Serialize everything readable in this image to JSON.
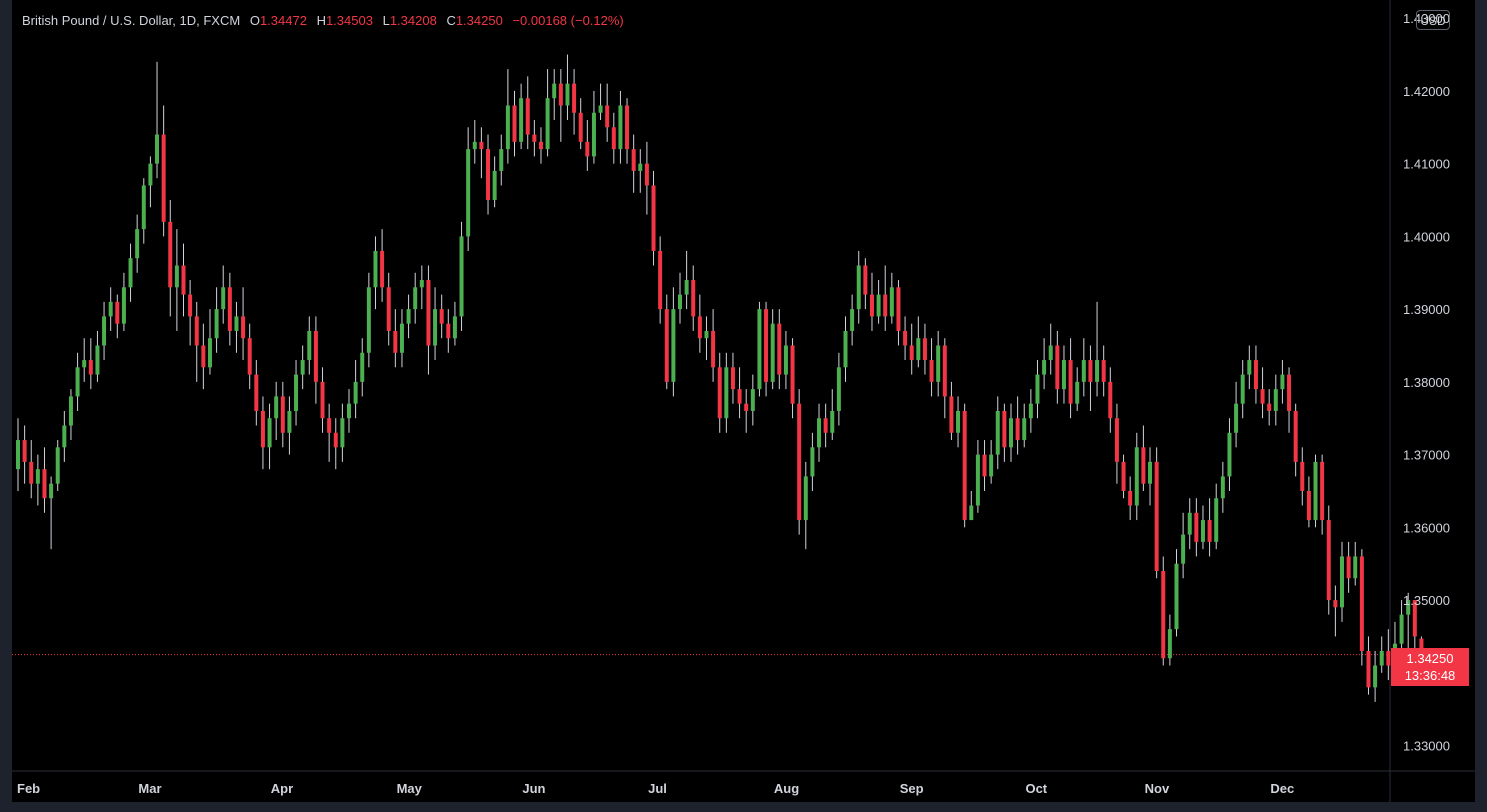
{
  "header": {
    "symbol": "British Pound / U.S. Dollar, 1D, FXCM",
    "open_label": "O",
    "open": "1.34472",
    "high_label": "H",
    "high": "1.34503",
    "low_label": "L",
    "low": "1.34208",
    "close_label": "C",
    "close": "1.34250",
    "change": "−0.00168 (−0.12%)"
  },
  "currency": "USD",
  "last_price": {
    "price": "1.34250",
    "countdown": "13:36:48",
    "value": 1.3425
  },
  "colors": {
    "up": "#4caf50",
    "down": "#f23645",
    "background": "#000000",
    "text": "#d1d4dc"
  },
  "chart_data": {
    "type": "candlestick",
    "y_ticks": [
      "1.43000",
      "1.42000",
      "1.41000",
      "1.40000",
      "1.39000",
      "1.38000",
      "1.37000",
      "1.36000",
      "1.35000",
      "1.34000",
      "1.33000"
    ],
    "ylim": [
      1.3265,
      1.4325
    ],
    "x_ticks": [
      {
        "label": "Feb",
        "index": 0
      },
      {
        "label": "Mar",
        "index": 20
      },
      {
        "label": "Apr",
        "index": 40
      },
      {
        "label": "May",
        "index": 59
      },
      {
        "label": "Jun",
        "index": 78
      },
      {
        "label": "Jul",
        "index": 97
      },
      {
        "label": "Aug",
        "index": 116
      },
      {
        "label": "Sep",
        "index": 135
      },
      {
        "label": "Oct",
        "index": 154
      },
      {
        "label": "Nov",
        "index": 172
      },
      {
        "label": "Dec",
        "index": 191
      }
    ],
    "candles": [
      [
        1.368,
        1.372,
        1.375,
        1.365
      ],
      [
        1.372,
        1.369,
        1.374,
        1.366
      ],
      [
        1.369,
        1.366,
        1.372,
        1.364
      ],
      [
        1.366,
        1.368,
        1.37,
        1.363
      ],
      [
        1.368,
        1.364,
        1.371,
        1.362
      ],
      [
        1.364,
        1.366,
        1.367,
        1.357
      ],
      [
        1.366,
        1.371,
        1.372,
        1.365
      ],
      [
        1.371,
        1.374,
        1.376,
        1.369
      ],
      [
        1.374,
        1.378,
        1.379,
        1.372
      ],
      [
        1.378,
        1.382,
        1.384,
        1.376
      ],
      [
        1.382,
        1.383,
        1.386,
        1.38
      ],
      [
        1.383,
        1.381,
        1.386,
        1.379
      ],
      [
        1.381,
        1.385,
        1.387,
        1.38
      ],
      [
        1.385,
        1.389,
        1.391,
        1.383
      ],
      [
        1.389,
        1.391,
        1.393,
        1.387
      ],
      [
        1.391,
        1.388,
        1.392,
        1.386
      ],
      [
        1.388,
        1.393,
        1.395,
        1.387
      ],
      [
        1.393,
        1.397,
        1.399,
        1.391
      ],
      [
        1.397,
        1.401,
        1.403,
        1.395
      ],
      [
        1.401,
        1.407,
        1.408,
        1.399
      ],
      [
        1.407,
        1.41,
        1.411,
        1.404
      ],
      [
        1.41,
        1.414,
        1.424,
        1.408
      ],
      [
        1.414,
        1.402,
        1.418,
        1.4
      ],
      [
        1.402,
        1.393,
        1.405,
        1.389
      ],
      [
        1.393,
        1.396,
        1.401,
        1.387
      ],
      [
        1.396,
        1.392,
        1.399,
        1.389
      ],
      [
        1.392,
        1.389,
        1.394,
        1.385
      ],
      [
        1.389,
        1.385,
        1.391,
        1.38
      ],
      [
        1.385,
        1.382,
        1.388,
        1.379
      ],
      [
        1.382,
        1.386,
        1.39,
        1.381
      ],
      [
        1.386,
        1.39,
        1.393,
        1.384
      ],
      [
        1.39,
        1.393,
        1.396,
        1.388
      ],
      [
        1.393,
        1.387,
        1.395,
        1.385
      ],
      [
        1.387,
        1.389,
        1.391,
        1.384
      ],
      [
        1.389,
        1.386,
        1.393,
        1.383
      ],
      [
        1.386,
        1.381,
        1.388,
        1.379
      ],
      [
        1.381,
        1.376,
        1.383,
        1.374
      ],
      [
        1.376,
        1.371,
        1.378,
        1.368
      ],
      [
        1.371,
        1.375,
        1.377,
        1.368
      ],
      [
        1.375,
        1.378,
        1.38,
        1.372
      ],
      [
        1.378,
        1.373,
        1.38,
        1.371
      ],
      [
        1.373,
        1.376,
        1.378,
        1.37
      ],
      [
        1.376,
        1.381,
        1.383,
        1.374
      ],
      [
        1.381,
        1.383,
        1.385,
        1.379
      ],
      [
        1.383,
        1.387,
        1.389,
        1.381
      ],
      [
        1.387,
        1.38,
        1.389,
        1.377
      ],
      [
        1.38,
        1.375,
        1.382,
        1.373
      ],
      [
        1.375,
        1.373,
        1.377,
        1.369
      ],
      [
        1.373,
        1.371,
        1.375,
        1.368
      ],
      [
        1.371,
        1.375,
        1.377,
        1.369
      ],
      [
        1.375,
        1.377,
        1.379,
        1.373
      ],
      [
        1.377,
        1.38,
        1.383,
        1.375
      ],
      [
        1.38,
        1.384,
        1.386,
        1.378
      ],
      [
        1.384,
        1.393,
        1.395,
        1.382
      ],
      [
        1.393,
        1.398,
        1.4,
        1.39
      ],
      [
        1.398,
        1.393,
        1.401,
        1.391
      ],
      [
        1.393,
        1.387,
        1.395,
        1.385
      ],
      [
        1.387,
        1.384,
        1.39,
        1.382
      ],
      [
        1.384,
        1.388,
        1.39,
        1.382
      ],
      [
        1.388,
        1.39,
        1.392,
        1.386
      ],
      [
        1.39,
        1.393,
        1.395,
        1.388
      ],
      [
        1.393,
        1.394,
        1.396,
        1.39
      ],
      [
        1.394,
        1.385,
        1.396,
        1.381
      ],
      [
        1.385,
        1.39,
        1.393,
        1.383
      ],
      [
        1.39,
        1.388,
        1.392,
        1.386
      ],
      [
        1.388,
        1.386,
        1.39,
        1.384
      ],
      [
        1.386,
        1.389,
        1.391,
        1.385
      ],
      [
        1.389,
        1.4,
        1.402,
        1.387
      ],
      [
        1.4,
        1.412,
        1.415,
        1.398
      ],
      [
        1.412,
        1.413,
        1.416,
        1.41
      ],
      [
        1.413,
        1.412,
        1.415,
        1.408
      ],
      [
        1.412,
        1.405,
        1.414,
        1.403
      ],
      [
        1.405,
        1.409,
        1.411,
        1.404
      ],
      [
        1.409,
        1.412,
        1.414,
        1.407
      ],
      [
        1.412,
        1.418,
        1.423,
        1.41
      ],
      [
        1.418,
        1.413,
        1.42,
        1.411
      ],
      [
        1.413,
        1.419,
        1.421,
        1.412
      ],
      [
        1.419,
        1.414,
        1.422,
        1.412
      ],
      [
        1.414,
        1.413,
        1.416,
        1.411
      ],
      [
        1.413,
        1.412,
        1.415,
        1.41
      ],
      [
        1.412,
        1.419,
        1.423,
        1.411
      ],
      [
        1.419,
        1.421,
        1.423,
        1.416
      ],
      [
        1.421,
        1.418,
        1.423,
        1.413
      ],
      [
        1.418,
        1.421,
        1.425,
        1.416
      ],
      [
        1.421,
        1.417,
        1.423,
        1.414
      ],
      [
        1.417,
        1.413,
        1.419,
        1.412
      ],
      [
        1.413,
        1.411,
        1.416,
        1.409
      ],
      [
        1.411,
        1.417,
        1.42,
        1.41
      ],
      [
        1.417,
        1.418,
        1.421,
        1.416
      ],
      [
        1.418,
        1.415,
        1.421,
        1.413
      ],
      [
        1.415,
        1.412,
        1.417,
        1.41
      ],
      [
        1.412,
        1.418,
        1.42,
        1.41
      ],
      [
        1.418,
        1.412,
        1.419,
        1.41
      ],
      [
        1.412,
        1.409,
        1.414,
        1.406
      ],
      [
        1.409,
        1.41,
        1.412,
        1.406
      ],
      [
        1.41,
        1.407,
        1.413,
        1.403
      ],
      [
        1.407,
        1.398,
        1.409,
        1.396
      ],
      [
        1.398,
        1.39,
        1.4,
        1.388
      ],
      [
        1.39,
        1.38,
        1.392,
        1.379
      ],
      [
        1.38,
        1.39,
        1.393,
        1.378
      ],
      [
        1.39,
        1.392,
        1.395,
        1.388
      ],
      [
        1.392,
        1.394,
        1.398,
        1.39
      ],
      [
        1.394,
        1.389,
        1.396,
        1.387
      ],
      [
        1.389,
        1.386,
        1.392,
        1.384
      ],
      [
        1.386,
        1.387,
        1.389,
        1.383
      ],
      [
        1.387,
        1.382,
        1.39,
        1.38
      ],
      [
        1.382,
        1.375,
        1.384,
        1.373
      ],
      [
        1.375,
        1.382,
        1.384,
        1.373
      ],
      [
        1.382,
        1.379,
        1.384,
        1.377
      ],
      [
        1.379,
        1.377,
        1.382,
        1.375
      ],
      [
        1.377,
        1.376,
        1.379,
        1.373
      ],
      [
        1.376,
        1.379,
        1.381,
        1.374
      ],
      [
        1.379,
        1.39,
        1.391,
        1.378
      ],
      [
        1.39,
        1.38,
        1.391,
        1.378
      ],
      [
        1.38,
        1.388,
        1.39,
        1.379
      ],
      [
        1.388,
        1.381,
        1.39,
        1.379
      ],
      [
        1.381,
        1.385,
        1.387,
        1.379
      ],
      [
        1.385,
        1.377,
        1.386,
        1.375
      ],
      [
        1.377,
        1.361,
        1.379,
        1.359
      ],
      [
        1.361,
        1.367,
        1.369,
        1.357
      ],
      [
        1.367,
        1.371,
        1.373,
        1.365
      ],
      [
        1.371,
        1.375,
        1.377,
        1.369
      ],
      [
        1.375,
        1.373,
        1.377,
        1.371
      ],
      [
        1.373,
        1.376,
        1.379,
        1.372
      ],
      [
        1.376,
        1.382,
        1.384,
        1.374
      ],
      [
        1.382,
        1.387,
        1.389,
        1.38
      ],
      [
        1.387,
        1.39,
        1.392,
        1.385
      ],
      [
        1.39,
        1.396,
        1.398,
        1.388
      ],
      [
        1.396,
        1.392,
        1.397,
        1.39
      ],
      [
        1.392,
        1.389,
        1.395,
        1.387
      ],
      [
        1.389,
        1.392,
        1.394,
        1.388
      ],
      [
        1.392,
        1.389,
        1.396,
        1.387
      ],
      [
        1.389,
        1.393,
        1.395,
        1.388
      ],
      [
        1.393,
        1.387,
        1.394,
        1.385
      ],
      [
        1.387,
        1.385,
        1.389,
        1.383
      ],
      [
        1.385,
        1.383,
        1.388,
        1.381
      ],
      [
        1.383,
        1.386,
        1.389,
        1.382
      ],
      [
        1.386,
        1.383,
        1.388,
        1.381
      ],
      [
        1.383,
        1.38,
        1.386,
        1.378
      ],
      [
        1.38,
        1.385,
        1.387,
        1.378
      ],
      [
        1.385,
        1.378,
        1.386,
        1.375
      ],
      [
        1.378,
        1.373,
        1.38,
        1.372
      ],
      [
        1.373,
        1.376,
        1.378,
        1.371
      ],
      [
        1.376,
        1.361,
        1.377,
        1.36
      ],
      [
        1.361,
        1.363,
        1.365,
        1.361
      ],
      [
        1.363,
        1.37,
        1.372,
        1.362
      ],
      [
        1.37,
        1.367,
        1.372,
        1.365
      ],
      [
        1.367,
        1.37,
        1.372,
        1.366
      ],
      [
        1.37,
        1.376,
        1.378,
        1.368
      ],
      [
        1.376,
        1.371,
        1.377,
        1.369
      ],
      [
        1.371,
        1.375,
        1.377,
        1.369
      ],
      [
        1.375,
        1.372,
        1.378,
        1.37
      ],
      [
        1.372,
        1.375,
        1.377,
        1.371
      ],
      [
        1.375,
        1.377,
        1.379,
        1.373
      ],
      [
        1.377,
        1.381,
        1.383,
        1.375
      ],
      [
        1.381,
        1.383,
        1.386,
        1.379
      ],
      [
        1.383,
        1.385,
        1.388,
        1.381
      ],
      [
        1.385,
        1.379,
        1.387,
        1.377
      ],
      [
        1.379,
        1.383,
        1.385,
        1.377
      ],
      [
        1.383,
        1.377,
        1.386,
        1.375
      ],
      [
        1.377,
        1.38,
        1.382,
        1.376
      ],
      [
        1.38,
        1.383,
        1.386,
        1.378
      ],
      [
        1.383,
        1.38,
        1.385,
        1.376
      ],
      [
        1.38,
        1.383,
        1.391,
        1.378
      ],
      [
        1.383,
        1.38,
        1.385,
        1.378
      ],
      [
        1.38,
        1.375,
        1.382,
        1.373
      ],
      [
        1.375,
        1.369,
        1.377,
        1.366
      ],
      [
        1.369,
        1.365,
        1.37,
        1.364
      ],
      [
        1.365,
        1.363,
        1.367,
        1.361
      ],
      [
        1.363,
        1.371,
        1.373,
        1.361
      ],
      [
        1.371,
        1.366,
        1.374,
        1.365
      ],
      [
        1.366,
        1.369,
        1.371,
        1.363
      ],
      [
        1.369,
        1.354,
        1.371,
        1.353
      ],
      [
        1.354,
        1.342,
        1.356,
        1.341
      ],
      [
        1.342,
        1.346,
        1.348,
        1.341
      ],
      [
        1.346,
        1.355,
        1.357,
        1.345
      ],
      [
        1.355,
        1.359,
        1.362,
        1.353
      ],
      [
        1.359,
        1.362,
        1.364,
        1.357
      ],
      [
        1.362,
        1.358,
        1.364,
        1.356
      ],
      [
        1.358,
        1.361,
        1.363,
        1.357
      ],
      [
        1.361,
        1.358,
        1.364,
        1.356
      ],
      [
        1.358,
        1.364,
        1.366,
        1.357
      ],
      [
        1.364,
        1.367,
        1.369,
        1.362
      ],
      [
        1.367,
        1.373,
        1.375,
        1.365
      ],
      [
        1.373,
        1.377,
        1.38,
        1.371
      ],
      [
        1.377,
        1.381,
        1.383,
        1.375
      ],
      [
        1.381,
        1.383,
        1.385,
        1.379
      ],
      [
        1.383,
        1.379,
        1.385,
        1.377
      ],
      [
        1.379,
        1.377,
        1.382,
        1.375
      ],
      [
        1.377,
        1.376,
        1.379,
        1.374
      ],
      [
        1.376,
        1.379,
        1.381,
        1.374
      ],
      [
        1.379,
        1.381,
        1.383,
        1.377
      ],
      [
        1.381,
        1.376,
        1.382,
        1.373
      ],
      [
        1.376,
        1.369,
        1.377,
        1.367
      ],
      [
        1.369,
        1.365,
        1.371,
        1.363
      ],
      [
        1.365,
        1.361,
        1.367,
        1.36
      ],
      [
        1.361,
        1.369,
        1.37,
        1.36
      ],
      [
        1.369,
        1.361,
        1.37,
        1.359
      ],
      [
        1.361,
        1.35,
        1.363,
        1.348
      ],
      [
        1.35,
        1.349,
        1.352,
        1.345
      ],
      [
        1.349,
        1.356,
        1.358,
        1.347
      ],
      [
        1.356,
        1.353,
        1.358,
        1.351
      ],
      [
        1.353,
        1.356,
        1.358,
        1.352
      ],
      [
        1.356,
        1.343,
        1.357,
        1.341
      ],
      [
        1.343,
        1.338,
        1.345,
        1.337
      ],
      [
        1.338,
        1.341,
        1.343,
        1.336
      ],
      [
        1.341,
        1.343,
        1.345,
        1.34
      ],
      [
        1.343,
        1.341,
        1.346,
        1.339
      ],
      [
        1.341,
        1.344,
        1.347,
        1.34
      ],
      [
        1.344,
        1.348,
        1.35,
        1.341
      ],
      [
        1.348,
        1.35,
        1.351,
        1.343
      ],
      [
        1.35,
        1.345,
        1.35,
        1.342
      ],
      [
        1.3447,
        1.3425,
        1.345,
        1.3421
      ]
    ]
  }
}
